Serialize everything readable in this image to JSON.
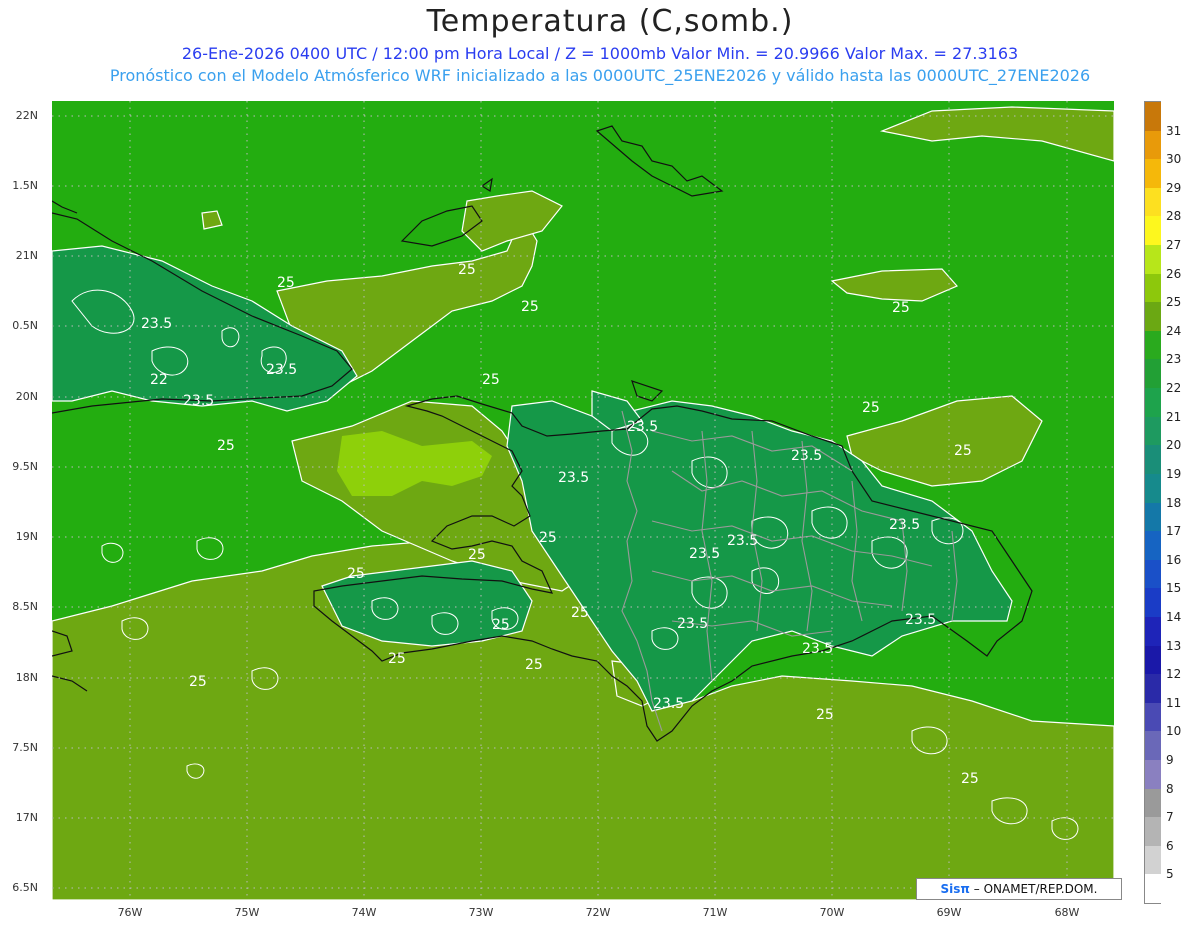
{
  "header": {
    "title": "Temperatura (C,somb.)",
    "line1": "26-Ene-2026 0400 UTC / 12:00 pm Hora Local / Z = 1000mb   Valor Min. = 20.9966  Valor Max. = 27.3163",
    "line2": "Pronóstico con el Modelo Atmósferico WRF inicializado a las 0000UTC_25ENE2026 y válido hasta las  0000UTC_27ENE2026"
  },
  "axes": {
    "lat_labels": [
      "22N",
      "1.5N",
      "21N",
      "0.5N",
      "20N",
      "9.5N",
      "19N",
      "8.5N",
      "18N",
      "7.5N",
      "17N",
      "6.5N"
    ],
    "lon_labels": [
      "76W",
      "75W",
      "74W",
      "73W",
      "72W",
      "71W",
      "70W",
      "69W",
      "68W"
    ]
  },
  "colorbar": {
    "labels": [
      "31",
      "30",
      "29",
      "28",
      "27",
      "26",
      "25",
      "24",
      "23",
      "22",
      "21",
      "20",
      "19",
      "18",
      "17",
      "16",
      "15",
      "14",
      "13",
      "12",
      "11",
      "10",
      "9",
      "8",
      "7",
      "6",
      "5"
    ],
    "colors": [
      "#c8780a",
      "#e89a0a",
      "#f5b80a",
      "#fde020",
      "#fdf71e",
      "#b7e61a",
      "#8dc80c",
      "#6ba813",
      "#2aaa1e",
      "#22a035",
      "#1ea34c",
      "#1e9a60",
      "#1a8e78",
      "#168a8c",
      "#1478a8",
      "#1664c2",
      "#1a50c8",
      "#1a3cc6",
      "#1e24b8",
      "#1a18a8",
      "#2a2aa8",
      "#4a4ab4",
      "#6a68b8",
      "#8a80c0",
      "#9a9a9a",
      "#b4b4b4",
      "#d2d2d2",
      "#ffffff"
    ]
  },
  "contour_labels": [
    "25",
    "23.5",
    "22"
  ],
  "credit": {
    "brand": "Sisπ",
    "text": "– ONAMET/REP.DOM."
  },
  "colors": {
    "sea": "#23ad10",
    "warm": "#6ea812",
    "warmer": "#8ed00a",
    "cool": "#159848"
  }
}
